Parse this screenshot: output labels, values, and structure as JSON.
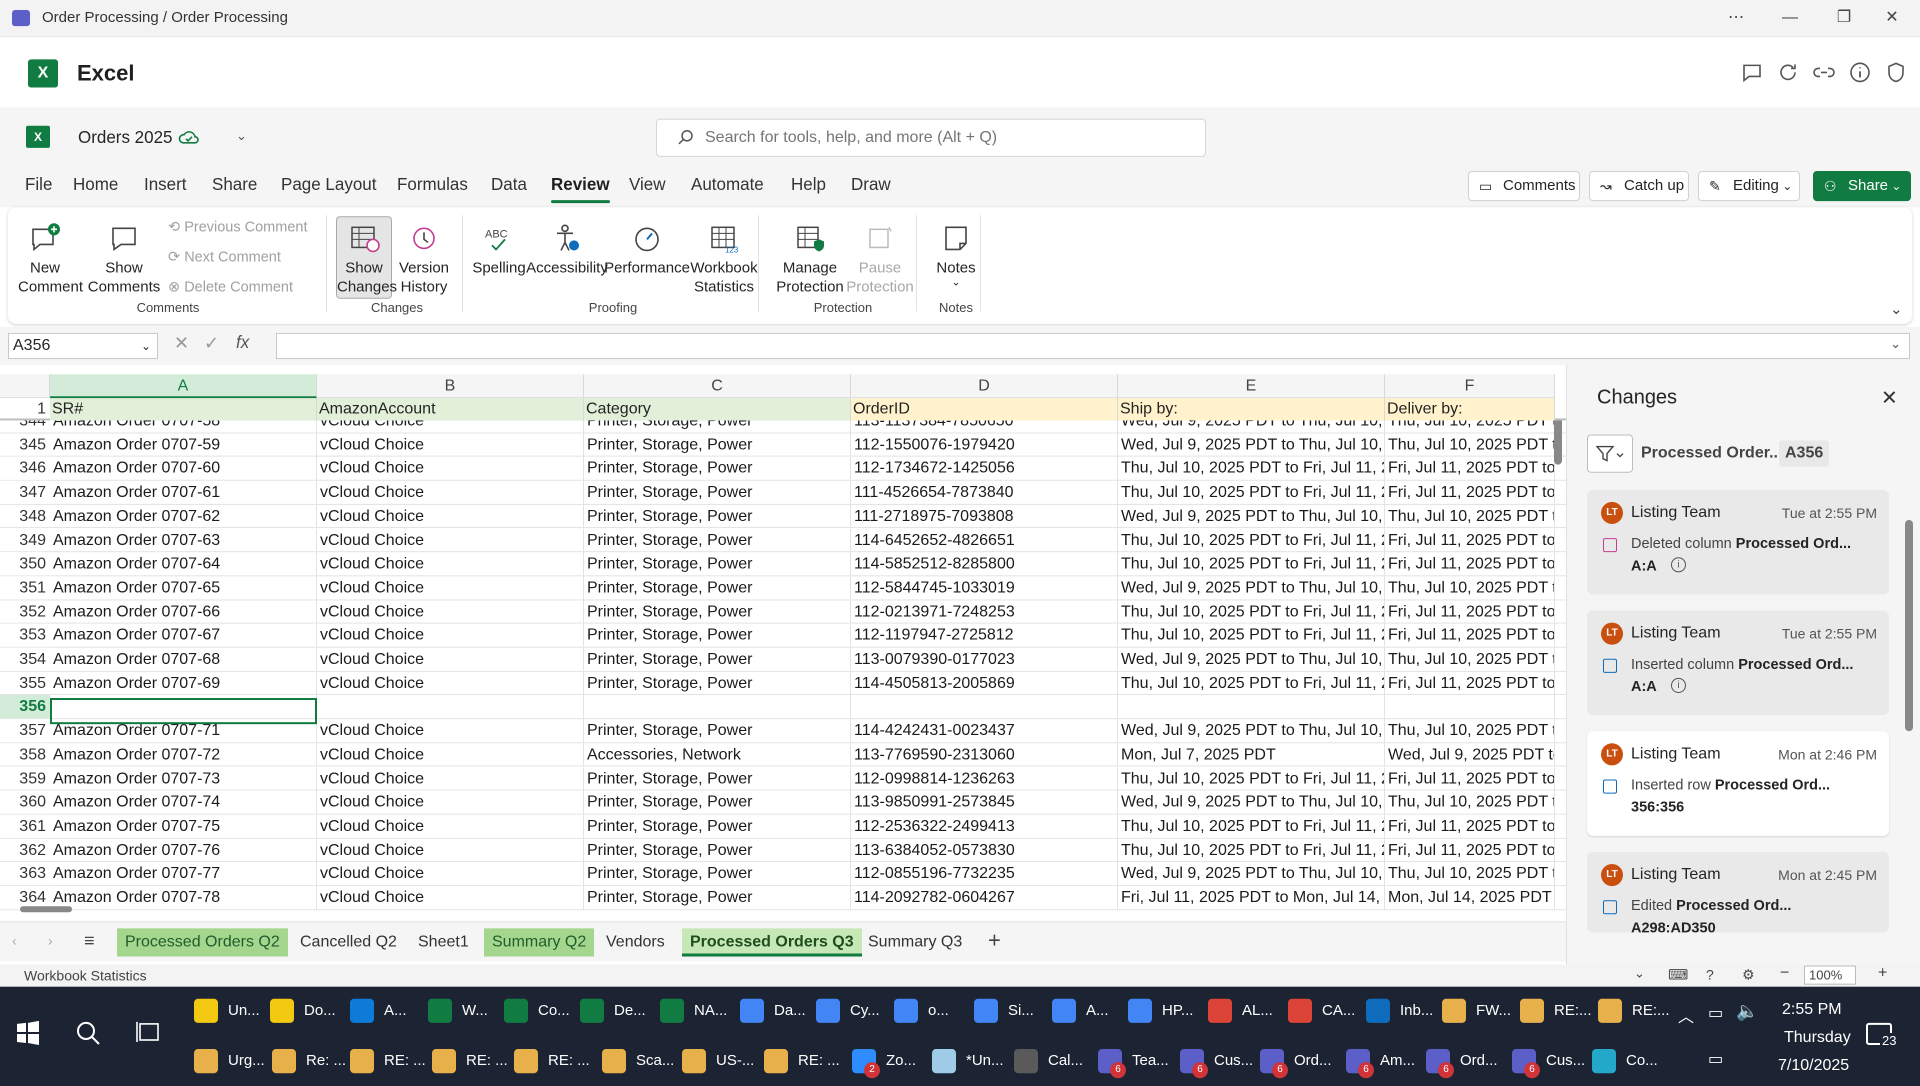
{
  "window": {
    "title": "Order Processing / Order Processing"
  },
  "app": {
    "name": "Excel"
  },
  "doc": {
    "title": "Orders 2025"
  },
  "search": {
    "placeholder": "Search for tools, help, and more (Alt + Q)"
  },
  "menu_tabs": [
    "File",
    "Home",
    "Insert",
    "Share",
    "Page Layout",
    "Formulas",
    "Data",
    "Review",
    "View",
    "Automate",
    "Help",
    "Draw"
  ],
  "active_tab": "Review",
  "header_buttons": {
    "comments": "Comments",
    "catchup": "Catch up",
    "editing": "Editing",
    "share": "Share"
  },
  "ribbon": {
    "new_comment": [
      "New",
      "Comment"
    ],
    "show_comments": [
      "Show",
      "Comments"
    ],
    "previous_comment": "Previous Comment",
    "next_comment": "Next Comment",
    "delete_comment": "Delete Comment",
    "show_changes": [
      "Show",
      "Changes"
    ],
    "version_history": [
      "Version",
      "History"
    ],
    "spelling": "Spelling",
    "accessibility": "Accessibility",
    "performance": "Performance",
    "workbook_statistics": [
      "Workbook",
      "Statistics"
    ],
    "manage_protection": [
      "Manage",
      "Protection"
    ],
    "pause_protection": [
      "Pause",
      "Protection"
    ],
    "notes": "Notes",
    "groups": {
      "comments": "Comments",
      "changes": "Changes",
      "proofing": "Proofing",
      "protection": "Protection",
      "notes": "Notes"
    }
  },
  "namebox": "A356",
  "fx": "fx",
  "columns": [
    "A",
    "B",
    "C",
    "D",
    "E",
    "F"
  ],
  "header_row": {
    "num": "1",
    "cells": [
      "SR#",
      "AmazonAccount",
      "Category",
      "OrderID",
      "Ship by:",
      "Deliver by:"
    ]
  },
  "rows": [
    {
      "n": "344",
      "a": "Amazon Order 0707-58",
      "b": "vCloud Choice",
      "c": "Printer, Storage, Power",
      "d": "113-1137384-7850650",
      "e": "Wed, Jul 9, 2025 PDT to Thu, Jul 10, 20",
      "f": "Thu, Jul 10, 2025 PDT to"
    },
    {
      "n": "345",
      "a": "Amazon Order 0707-59",
      "b": "vCloud Choice",
      "c": "Printer, Storage, Power",
      "d": "112-1550076-1979420",
      "e": "Wed, Jul 9, 2025 PDT to Thu, Jul 10, 20",
      "f": "Thu, Jul 10, 2025 PDT to"
    },
    {
      "n": "346",
      "a": "Amazon Order 0707-60",
      "b": "vCloud Choice",
      "c": "Printer, Storage, Power",
      "d": "112-1734672-1425056",
      "e": "Thu, Jul 10, 2025 PDT to Fri, Jul 11, 20",
      "f": "Fri, Jul 11, 2025 PDT to T"
    },
    {
      "n": "347",
      "a": "Amazon Order 0707-61",
      "b": "vCloud Choice",
      "c": "Printer, Storage, Power",
      "d": "111-4526654-7873840",
      "e": "Thu, Jul 10, 2025 PDT to Fri, Jul 11, 20",
      "f": "Fri, Jul 11, 2025 PDT to T"
    },
    {
      "n": "348",
      "a": "Amazon Order 0707-62",
      "b": "vCloud Choice",
      "c": "Printer, Storage, Power",
      "d": "111-2718975-7093808",
      "e": "Wed, Jul 9, 2025 PDT to Thu, Jul 10, 20",
      "f": "Thu, Jul 10, 2025 PDT to"
    },
    {
      "n": "349",
      "a": "Amazon Order 0707-63",
      "b": "vCloud Choice",
      "c": "Printer, Storage, Power",
      "d": "114-6452652-4826651",
      "e": "Thu, Jul 10, 2025 PDT to Fri, Jul 11, 20",
      "f": "Fri, Jul 11, 2025 PDT to T"
    },
    {
      "n": "350",
      "a": "Amazon Order 0707-64",
      "b": "vCloud Choice",
      "c": "Printer, Storage, Power",
      "d": "114-5852512-8285800",
      "e": "Thu, Jul 10, 2025 PDT to Fri, Jul 11, 20",
      "f": "Fri, Jul 11, 2025 PDT to T"
    },
    {
      "n": "351",
      "a": "Amazon Order 0707-65",
      "b": "vCloud Choice",
      "c": "Printer, Storage, Power",
      "d": "112-5844745-1033019",
      "e": "Wed, Jul 9, 2025 PDT to Thu, Jul 10, 20",
      "f": "Thu, Jul 10, 2025 PDT to"
    },
    {
      "n": "352",
      "a": "Amazon Order 0707-66",
      "b": "vCloud Choice",
      "c": "Printer, Storage, Power",
      "d": "112-0213971-7248253",
      "e": "Thu, Jul 10, 2025 PDT to Fri, Jul 11, 20",
      "f": "Fri, Jul 11, 2025 PDT to T"
    },
    {
      "n": "353",
      "a": "Amazon Order 0707-67",
      "b": "vCloud Choice",
      "c": "Printer, Storage, Power",
      "d": "112-1197947-2725812",
      "e": "Thu, Jul 10, 2025 PDT to Fri, Jul 11, 20",
      "f": "Fri, Jul 11, 2025 PDT to T"
    },
    {
      "n": "354",
      "a": "Amazon Order 0707-68",
      "b": "vCloud Choice",
      "c": "Printer, Storage, Power",
      "d": "113-0079390-0177023",
      "e": "Wed, Jul 9, 2025 PDT to Thu, Jul 10, 20",
      "f": "Thu, Jul 10, 2025 PDT to"
    },
    {
      "n": "355",
      "a": "Amazon Order 0707-69",
      "b": "vCloud Choice",
      "c": "Printer, Storage, Power",
      "d": "114-4505813-2005869",
      "e": "Thu, Jul 10, 2025 PDT to Fri, Jul 11, 20",
      "f": "Fri, Jul 11, 2025 PDT to T"
    },
    {
      "n": "356",
      "a": "",
      "b": "",
      "c": "",
      "d": "",
      "e": "",
      "f": ""
    },
    {
      "n": "357",
      "a": "Amazon Order 0707-71",
      "b": "vCloud Choice",
      "c": "Printer, Storage, Power",
      "d": "114-4242431-0023437",
      "e": "Wed, Jul 9, 2025 PDT to Thu, Jul 10, 20",
      "f": "Thu, Jul 10, 2025 PDT to"
    },
    {
      "n": "358",
      "a": "Amazon Order 0707-72",
      "b": "vCloud Choice",
      "c": "Accessories, Network",
      "d": "113-7769590-2313060",
      "e": "Mon, Jul 7, 2025 PDT",
      "f": "Wed, Jul 9, 2025 PDT to"
    },
    {
      "n": "359",
      "a": "Amazon Order 0707-73",
      "b": "vCloud Choice",
      "c": "Printer, Storage, Power",
      "d": "112-0998814-1236263",
      "e": "Thu, Jul 10, 2025 PDT to Fri, Jul 11, 20",
      "f": "Fri, Jul 11, 2025 PDT to T"
    },
    {
      "n": "360",
      "a": "Amazon Order 0707-74",
      "b": "vCloud Choice",
      "c": "Printer, Storage, Power",
      "d": "113-9850991-2573845",
      "e": "Wed, Jul 9, 2025 PDT to Thu, Jul 10, 20",
      "f": "Thu, Jul 10, 2025 PDT to"
    },
    {
      "n": "361",
      "a": "Amazon Order 0707-75",
      "b": "vCloud Choice",
      "c": "Printer, Storage, Power",
      "d": "112-2536322-2499413",
      "e": "Thu, Jul 10, 2025 PDT to Fri, Jul 11, 20",
      "f": "Fri, Jul 11, 2025 PDT to T"
    },
    {
      "n": "362",
      "a": "Amazon Order 0707-76",
      "b": "vCloud Choice",
      "c": "Printer, Storage, Power",
      "d": "113-6384052-0573830",
      "e": "Thu, Jul 10, 2025 PDT to Fri, Jul 11, 20",
      "f": "Fri, Jul 11, 2025 PDT to T"
    },
    {
      "n": "363",
      "a": "Amazon Order 0707-77",
      "b": "vCloud Choice",
      "c": "Printer, Storage, Power",
      "d": "112-0855196-7732235",
      "e": "Wed, Jul 9, 2025 PDT to Thu, Jul 10, 20",
      "f": "Thu, Jul 10, 2025 PDT to"
    },
    {
      "n": "364",
      "a": "Amazon Order 0707-78",
      "b": "vCloud Choice",
      "c": "Printer, Storage, Power",
      "d": "114-2092782-0604267",
      "e": "Fri, Jul 11, 2025 PDT to Mon, Jul 14, 20",
      "f": "Mon, Jul 14, 2025 PDT t"
    }
  ],
  "sheet_tabs": [
    {
      "label": "Processed Orders Q2",
      "style": "green"
    },
    {
      "label": "Cancelled Q2",
      "style": "plain"
    },
    {
      "label": "Sheet1",
      "style": "plain"
    },
    {
      "label": "Summary Q2",
      "style": "green"
    },
    {
      "label": "Vendors",
      "style": "plain"
    },
    {
      "label": "Processed Orders Q3",
      "style": "active"
    },
    {
      "label": "Summary Q3",
      "style": "plain"
    }
  ],
  "changes_pane": {
    "title": "Changes",
    "filter_label": "Processed Order...",
    "filter_ref": "A356",
    "cards": [
      {
        "initials": "LT",
        "name": "Listing Team",
        "time": "Tue at 2:55 PM",
        "action": "Deleted column",
        "target": "Processed Ord...",
        "ref": "A:A",
        "icon": "delete-column-icon",
        "style": "grey"
      },
      {
        "initials": "LT",
        "name": "Listing Team",
        "time": "Tue at 2:55 PM",
        "action": "Inserted column",
        "target": "Processed Ord...",
        "ref": "A:A",
        "icon": "insert-column-icon",
        "style": "grey"
      },
      {
        "initials": "LT",
        "name": "Listing Team",
        "time": "Mon at 2:46 PM",
        "action": "Inserted row",
        "target": "Processed Ord...",
        "ref": "356:356",
        "icon": "insert-row-icon",
        "style": "white"
      },
      {
        "initials": "LT",
        "name": "Listing Team",
        "time": "Mon at 2:45 PM",
        "action": "Edited",
        "target": "Processed Ord...",
        "ref": "A298:AD350",
        "icon": "edit-icon",
        "style": "grey"
      }
    ]
  },
  "status": {
    "left": "Workbook Statistics",
    "zoom": "100%"
  },
  "taskbar": {
    "row1": [
      {
        "label": "Un...",
        "color": "#f2c811"
      },
      {
        "label": "Do...",
        "color": "#f2c811"
      },
      {
        "label": "A...",
        "color": "#0f7bd8"
      },
      {
        "label": "W...",
        "color": "#107c41"
      },
      {
        "label": "Co...",
        "color": "#107c41"
      },
      {
        "label": "De...",
        "color": "#107c41"
      },
      {
        "label": "NA...",
        "color": "#107c41"
      },
      {
        "label": "Da...",
        "color": "#4285f4"
      },
      {
        "label": "Cy...",
        "color": "#4285f4"
      },
      {
        "label": "o...",
        "color": "#4285f4"
      },
      {
        "label": "Si...",
        "color": "#4285f4"
      },
      {
        "label": "A...",
        "color": "#4285f4"
      },
      {
        "label": "HP...",
        "color": "#4285f4"
      },
      {
        "label": "AL...",
        "color": "#db4437"
      },
      {
        "label": "CA...",
        "color": "#db4437"
      },
      {
        "label": "Inb...",
        "color": "#0f6cbd"
      },
      {
        "label": "FW...",
        "color": "#e8b04a"
      },
      {
        "label": "RE:...",
        "color": "#e8b04a"
      },
      {
        "label": "RE:...",
        "color": "#e8b04a"
      }
    ],
    "row2": [
      {
        "label": "Urg...",
        "color": "#e8b04a"
      },
      {
        "label": "Re: ...",
        "color": "#e8b04a"
      },
      {
        "label": "RE: ...",
        "color": "#e8b04a"
      },
      {
        "label": "RE: ...",
        "color": "#e8b04a"
      },
      {
        "label": "RE: ...",
        "color": "#e8b04a"
      },
      {
        "label": "Sca...",
        "color": "#e8b04a"
      },
      {
        "label": "US-...",
        "color": "#e8b04a"
      },
      {
        "label": "RE: ...",
        "color": "#e8b04a"
      },
      {
        "label": "Zo...",
        "color": "#2d8cff"
      },
      {
        "label": "*Un...",
        "color": "#9ecbe8"
      },
      {
        "label": "Cal...",
        "color": "#5a5a5a"
      },
      {
        "label": "Tea...",
        "color": "#5b5fc7"
      },
      {
        "label": "Cus...",
        "color": "#5b5fc7"
      },
      {
        "label": "Ord...",
        "color": "#5b5fc7"
      },
      {
        "label": "Am...",
        "color": "#5b5fc7"
      },
      {
        "label": "Ord...",
        "color": "#5b5fc7"
      },
      {
        "label": "Cus...",
        "color": "#5b5fc7"
      },
      {
        "label": "Co...",
        "color": "#23a8c9"
      }
    ],
    "badges": {
      "zoom": "2",
      "teams": "6"
    },
    "time": "2:55 PM",
    "day": "Thursday",
    "date": "7/10/2025",
    "notif": "23"
  }
}
